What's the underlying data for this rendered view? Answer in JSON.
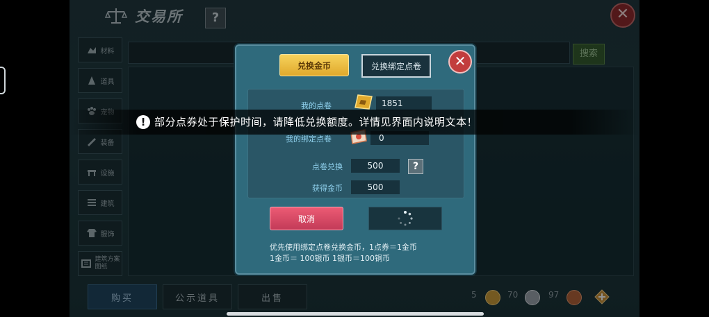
{
  "header": {
    "title": "交易所",
    "help_label": "?",
    "close_label": "✕"
  },
  "search": {
    "button_label": "搜索"
  },
  "categories": [
    {
      "label": "材料",
      "icon": "material-icon"
    },
    {
      "label": "道具",
      "icon": "prop-icon"
    },
    {
      "label": "宠物",
      "icon": "pet-paw-icon"
    },
    {
      "label": "装备",
      "icon": "equipment-icon"
    },
    {
      "label": "设施",
      "icon": "facility-icon"
    },
    {
      "label": "建筑",
      "icon": "building-icon"
    },
    {
      "label": "服饰",
      "icon": "clothing-icon"
    },
    {
      "label": "建筑方案图纸",
      "icon": "blueprint-icon"
    }
  ],
  "bottom_tabs": [
    {
      "label": "购买",
      "active": true
    },
    {
      "label": "公示道具",
      "active": false
    },
    {
      "label": "出售",
      "active": false
    }
  ],
  "currencies": [
    {
      "amount": "5",
      "icon": "gold-coin-icon",
      "color": "#c99a3a"
    },
    {
      "amount": "70",
      "icon": "silver-coin-icon",
      "color": "#9aa3ab"
    },
    {
      "amount": "97",
      "icon": "copper-coin-icon",
      "color": "#b1623a"
    }
  ],
  "dialog": {
    "tab_active": "兑换金币",
    "tab_inactive": "兑换绑定点卷",
    "close_label": "✕",
    "my_coupon_label": "我的点卷",
    "my_coupon_value": "1851",
    "bound_coupon_label": "我的绑定点卷",
    "bound_coupon_value": "0",
    "exchange_label": "点卷兑换",
    "exchange_value": "500",
    "gain_label": "获得金币",
    "gain_value": "500",
    "help_label": "?",
    "cancel_label": "取消",
    "note_line1": "优先使用绑定点卷兑换金币，1点券＝1金币",
    "note_line2": "1金币＝ 100银币 1银币＝100铜币"
  },
  "toast": {
    "icon_label": "!",
    "text": "部分点券处于保护时间，请降低兑换额度。详情见界面内说明文本！"
  }
}
